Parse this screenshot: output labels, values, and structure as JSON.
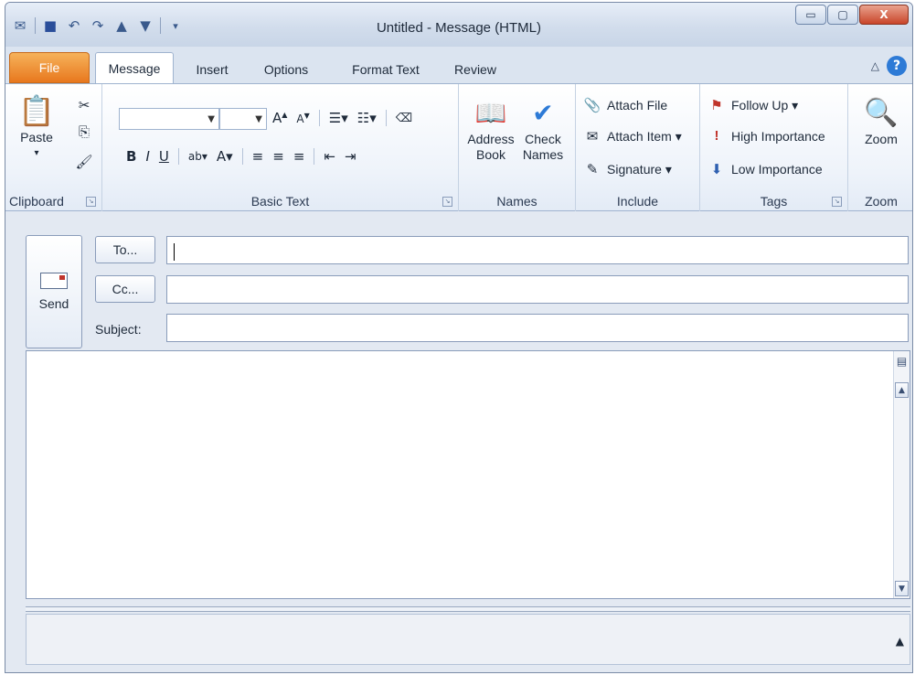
{
  "window": {
    "title": "Untitled - Message (HTML)",
    "controls": {
      "minimize": "▭",
      "maximize": "▢",
      "close": "X"
    }
  },
  "quick_access": {
    "icons": [
      "outlook-icon",
      "save-icon",
      "undo-icon",
      "redo-icon",
      "up-icon",
      "down-icon",
      "customize-icon"
    ]
  },
  "tabs": [
    {
      "label": "File"
    },
    {
      "label": "Message"
    },
    {
      "label": "Insert"
    },
    {
      "label": "Options"
    },
    {
      "label": "Format Text"
    },
    {
      "label": "Review"
    }
  ],
  "ribbon": {
    "clipboard": {
      "label": "Clipboard",
      "paste": "Paste"
    },
    "basic_text": {
      "label": "Basic Text"
    },
    "names": {
      "label": "Names",
      "address_book": "Address Book",
      "check_names": "Check Names"
    },
    "include": {
      "label": "Include",
      "attach_file": "Attach File",
      "attach_item": "Attach Item ▾",
      "signature": "Signature ▾"
    },
    "tags": {
      "label": "Tags",
      "follow_up": "Follow Up ▾",
      "high_importance": "High Importance",
      "low_importance": "Low Importance"
    },
    "zoom": {
      "label": "Zoom",
      "zoom_button": "Zoom"
    }
  },
  "compose": {
    "send": "Send",
    "to_button": "To...",
    "cc_button": "Cc...",
    "subject_label": "Subject:",
    "to_value": "",
    "cc_value": "",
    "subject_value": ""
  },
  "colors": {
    "file_tab": "#e8781e",
    "help": "#2d7ad6",
    "close": "#c9452a"
  }
}
